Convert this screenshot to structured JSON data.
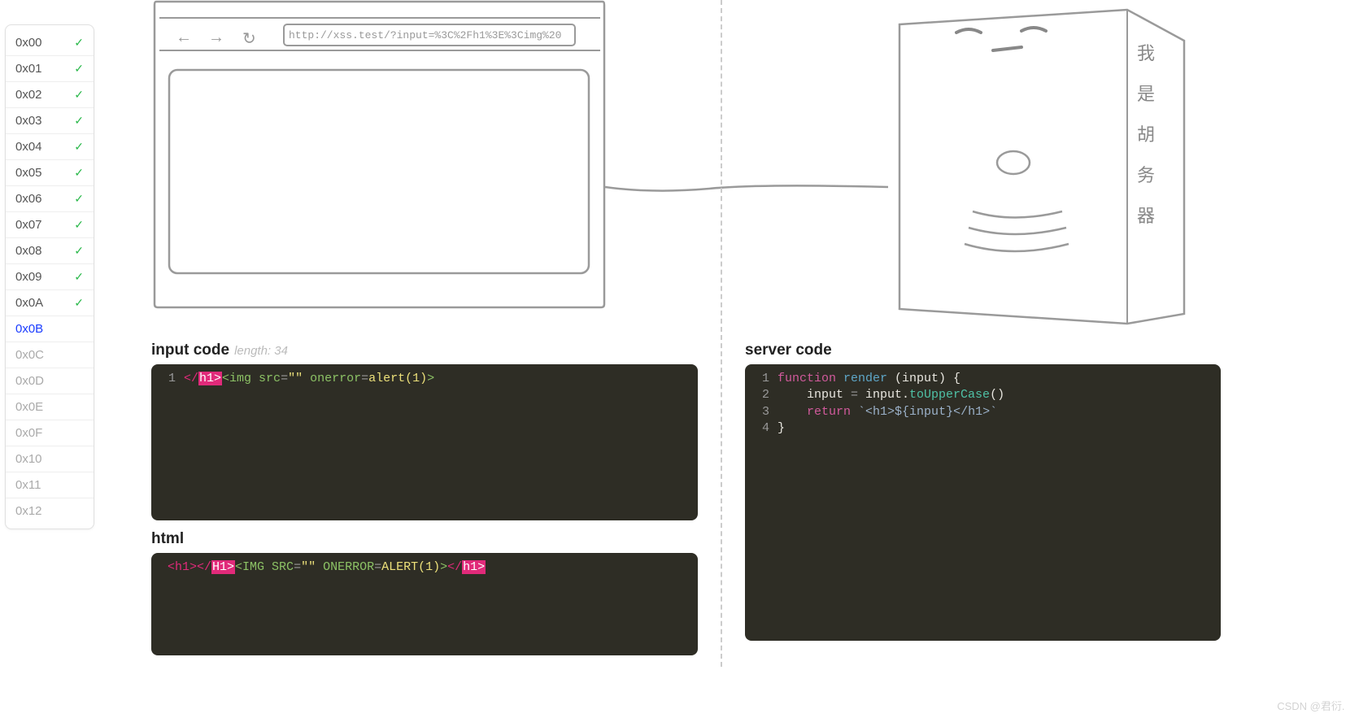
{
  "sidebar": {
    "items": [
      {
        "label": "0x00",
        "done": true,
        "active": false
      },
      {
        "label": "0x01",
        "done": true,
        "active": false
      },
      {
        "label": "0x02",
        "done": true,
        "active": false
      },
      {
        "label": "0x03",
        "done": true,
        "active": false
      },
      {
        "label": "0x04",
        "done": true,
        "active": false
      },
      {
        "label": "0x05",
        "done": true,
        "active": false
      },
      {
        "label": "0x06",
        "done": true,
        "active": false
      },
      {
        "label": "0x07",
        "done": true,
        "active": false
      },
      {
        "label": "0x08",
        "done": true,
        "active": false
      },
      {
        "label": "0x09",
        "done": true,
        "active": false
      },
      {
        "label": "0x0A",
        "done": true,
        "active": false
      },
      {
        "label": "0x0B",
        "done": false,
        "active": true
      },
      {
        "label": "0x0C",
        "done": false,
        "active": false
      },
      {
        "label": "0x0D",
        "done": false,
        "active": false
      },
      {
        "label": "0x0E",
        "done": false,
        "active": false
      },
      {
        "label": "0x0F",
        "done": false,
        "active": false
      },
      {
        "label": "0x10",
        "done": false,
        "active": false
      },
      {
        "label": "0x11",
        "done": false,
        "active": false
      },
      {
        "label": "0x12",
        "done": false,
        "active": false
      }
    ]
  },
  "browser": {
    "url": "http://xss.test/?input=%3C%2Fh1%3E%3Cimg%20"
  },
  "server_label": "我是胡务器",
  "input_code": {
    "title": "input code",
    "length_label": "length: 34",
    "lines": [
      {
        "n": "1",
        "parts": [
          {
            "c": "t-tag",
            "t": "</"
          },
          {
            "c": "t-tag-hl",
            "t": "h1>"
          },
          {
            "c": "t-green",
            "t": "<img "
          },
          {
            "c": "t-green",
            "t": "src"
          },
          {
            "c": "t-gray",
            "t": "="
          },
          {
            "c": "t-yellow",
            "t": "\"\""
          },
          {
            "c": "t-green",
            "t": " onerror"
          },
          {
            "c": "t-gray",
            "t": "="
          },
          {
            "c": "t-yellow",
            "t": "alert(1)"
          },
          {
            "c": "t-green",
            "t": ">"
          }
        ]
      }
    ]
  },
  "html_output": {
    "title": "html",
    "lines": [
      {
        "parts": [
          {
            "c": "t-tag",
            "t": "<h1>"
          },
          {
            "c": "t-tag",
            "t": "</"
          },
          {
            "c": "t-tag-hl",
            "t": "H1>"
          },
          {
            "c": "t-green",
            "t": "<IMG SRC"
          },
          {
            "c": "t-gray",
            "t": "="
          },
          {
            "c": "t-yellow",
            "t": "\"\""
          },
          {
            "c": "t-green",
            "t": " ONERROR"
          },
          {
            "c": "t-gray",
            "t": "="
          },
          {
            "c": "t-yellow",
            "t": "ALERT(1)"
          },
          {
            "c": "t-green",
            "t": ">"
          },
          {
            "c": "t-tag",
            "t": "</"
          },
          {
            "c": "t-tag-hl",
            "t": "h1>"
          }
        ]
      }
    ]
  },
  "server_code": {
    "title": "server code",
    "lines": [
      {
        "n": "1",
        "parts": [
          {
            "c": "t-keyword",
            "t": "function"
          },
          {
            "c": "t-white",
            "t": " "
          },
          {
            "c": "t-blue",
            "t": "render"
          },
          {
            "c": "t-white",
            "t": " (input) {"
          }
        ]
      },
      {
        "n": "2",
        "parts": [
          {
            "c": "t-white",
            "t": "    input "
          },
          {
            "c": "t-gray",
            "t": "="
          },
          {
            "c": "t-white",
            "t": " input."
          },
          {
            "c": "t-cyan",
            "t": "toUpperCase"
          },
          {
            "c": "t-white",
            "t": "()"
          }
        ]
      },
      {
        "n": "3",
        "parts": [
          {
            "c": "t-white",
            "t": "    "
          },
          {
            "c": "t-keyword",
            "t": "return"
          },
          {
            "c": "t-white",
            "t": " "
          },
          {
            "c": "t-paleblue",
            "t": "`<h1>${input}</h1>`"
          }
        ]
      },
      {
        "n": "4",
        "parts": [
          {
            "c": "t-white",
            "t": "}"
          }
        ]
      }
    ]
  },
  "watermark": "CSDN @君衍.⠀"
}
